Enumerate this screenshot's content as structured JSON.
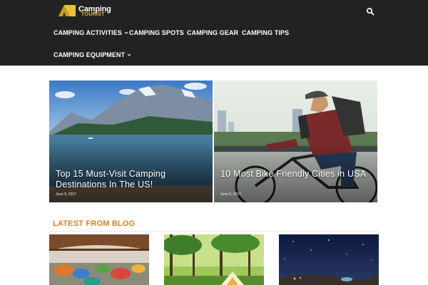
{
  "brand": {
    "line1": "Camping",
    "line2": "TOURIST",
    "accent_color": "#e9c13a"
  },
  "nav": {
    "items": [
      {
        "label": "CAMPING ACTIVITIES",
        "has_dropdown": true
      },
      {
        "label": "CAMPING SPOTS",
        "has_dropdown": false
      },
      {
        "label": "CAMPING GEAR",
        "has_dropdown": false
      },
      {
        "label": "CAMPING TIPS",
        "has_dropdown": false
      },
      {
        "label": "CAMPING EQUIPMENT",
        "has_dropdown": true
      }
    ],
    "search_icon": "search-icon"
  },
  "featured": [
    {
      "title": "Top 15 Must-Visit Camping Destinations In The US!",
      "date": "June 9, 2017"
    },
    {
      "title": "10 Most Bike Friendly Cities in USA",
      "date": "June 6, 2017"
    }
  ],
  "latest": {
    "heading": "LATEST FROM BLOG",
    "heading_color": "#d6841c"
  },
  "colors": {
    "header_bg": "#222222",
    "nav_text": "#ffffff"
  }
}
